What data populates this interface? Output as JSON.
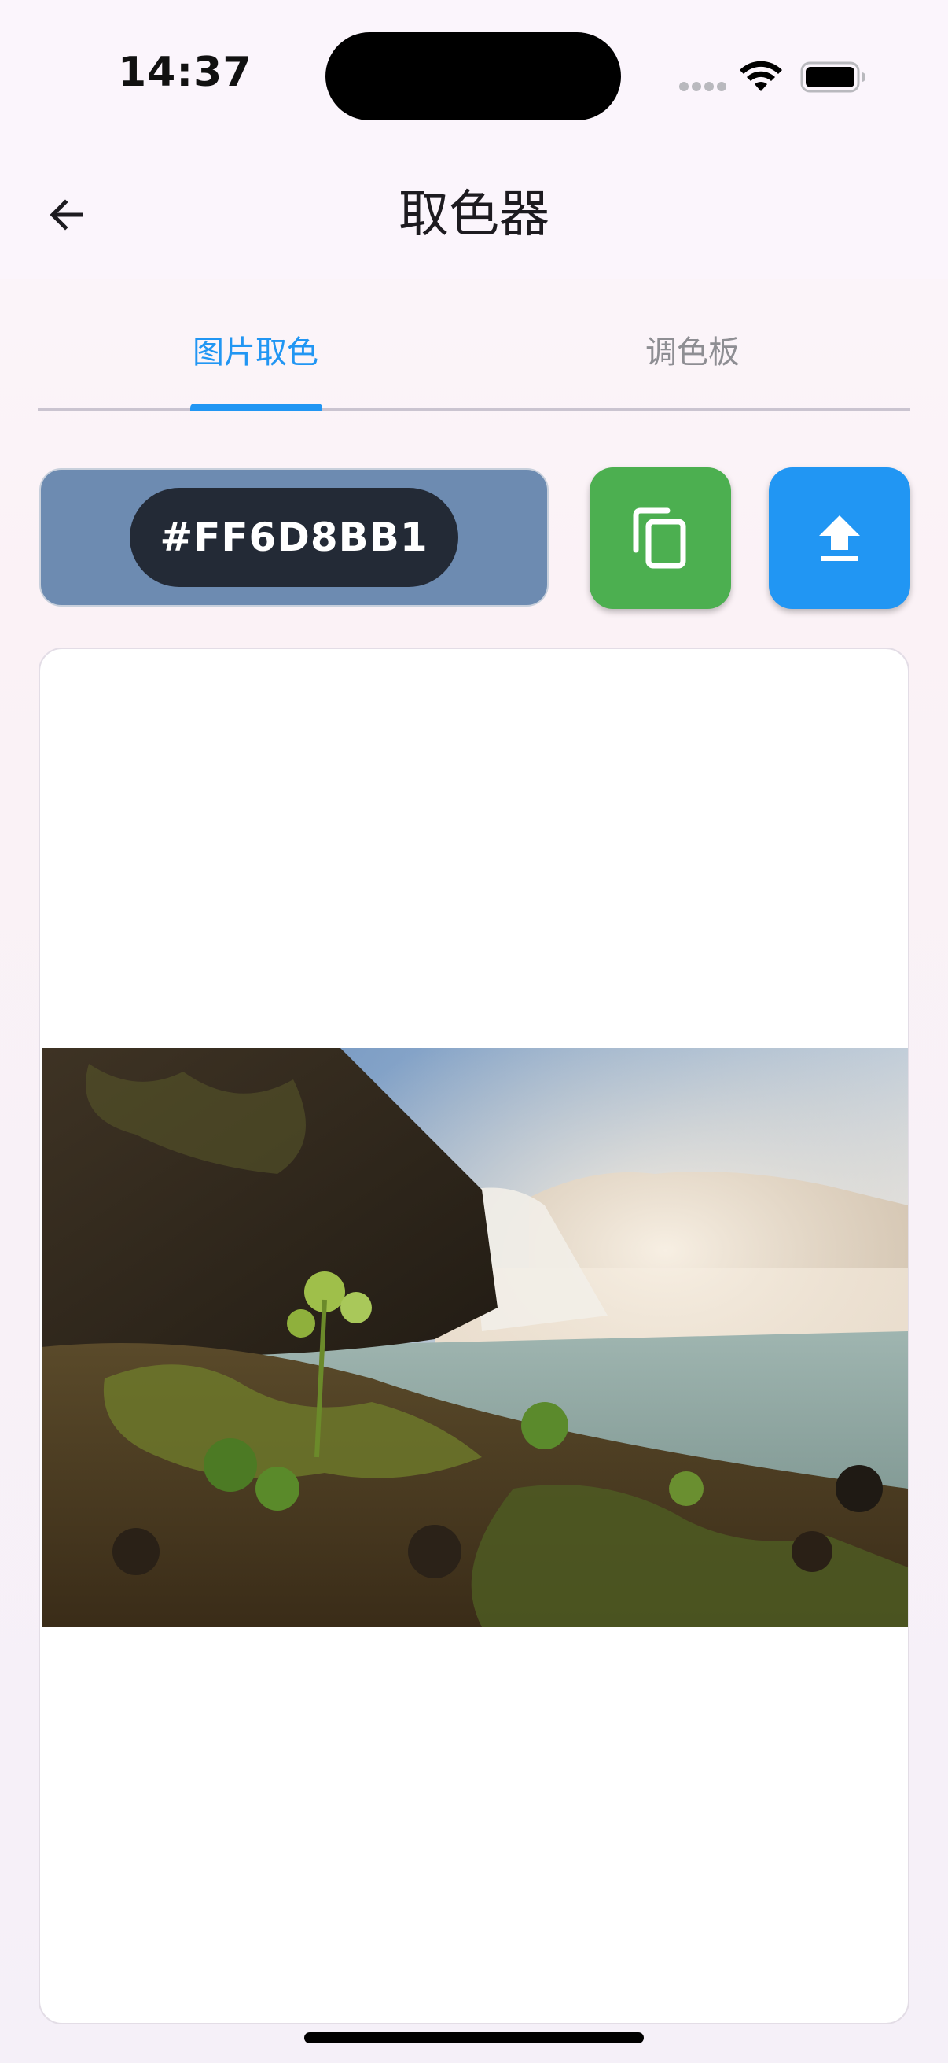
{
  "status_bar": {
    "time": "14:37"
  },
  "header": {
    "title": "取色器",
    "back_icon": "arrow-left-icon"
  },
  "tabs": [
    {
      "label": "图片取色",
      "active": true
    },
    {
      "label": "调色板",
      "active": false
    }
  ],
  "picker": {
    "selected_color_hex": "#FF6D8BB1",
    "preview_color": "#6D8BB1",
    "copy_icon": "copy-icon",
    "copy_color": "#4CAF50",
    "upload_icon": "upload-icon",
    "upload_color": "#2196F3"
  },
  "colors": {
    "accent": "#2196F3",
    "inactive_tab": "#8E8E93"
  }
}
